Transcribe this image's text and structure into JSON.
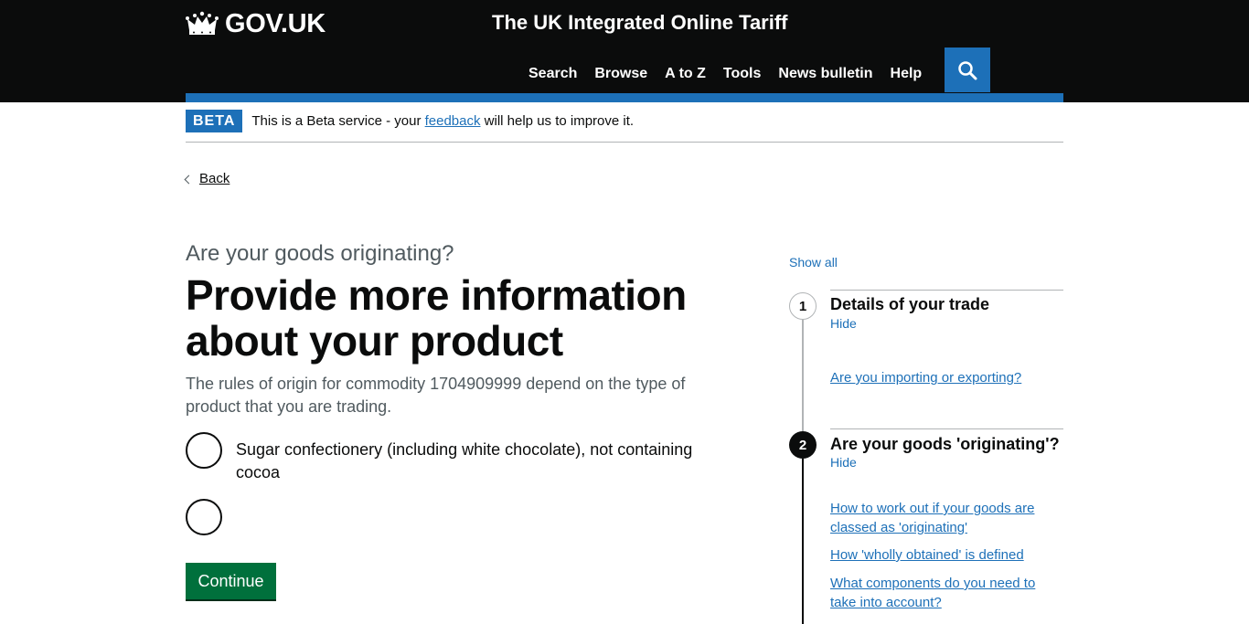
{
  "header": {
    "logo_text": "GOV.UK",
    "service_name": "The UK Integrated Online Tariff",
    "nav": [
      "Search",
      "Browse",
      "A to Z",
      "Tools",
      "News bulletin",
      "Help"
    ]
  },
  "beta": {
    "tag": "BETA",
    "text_before": "This is a Beta service - your ",
    "link": "feedback",
    "text_after": " will help us to improve it."
  },
  "back_link": "Back",
  "main": {
    "caption": "Are your goods originating?",
    "heading": "Provide more information about your product",
    "lead": "The rules of origin for commodity 1704909999 depend on the type of product that you are trading.",
    "options": [
      "Sugar confectionery (including white chocolate), not containing cocoa",
      ""
    ],
    "continue_label": "Continue"
  },
  "step_nav": {
    "show_all": "Show all",
    "steps": [
      {
        "number": "1",
        "title": "Details of your trade",
        "toggle": "Hide",
        "links": [
          "Are you importing or exporting?"
        ]
      },
      {
        "number": "2",
        "title": "Are your goods 'originating'?",
        "toggle": "Hide",
        "links": [
          "How to work out if your goods are classed as 'originating'",
          "How 'wholly obtained' is defined",
          "What components do you need to take into account?"
        ]
      }
    ]
  },
  "colors": {
    "header_bg": "#0b0c0c",
    "brand_blue": "#1d70b8",
    "button_green": "#00703c",
    "secondary_text": "#505a5f"
  }
}
